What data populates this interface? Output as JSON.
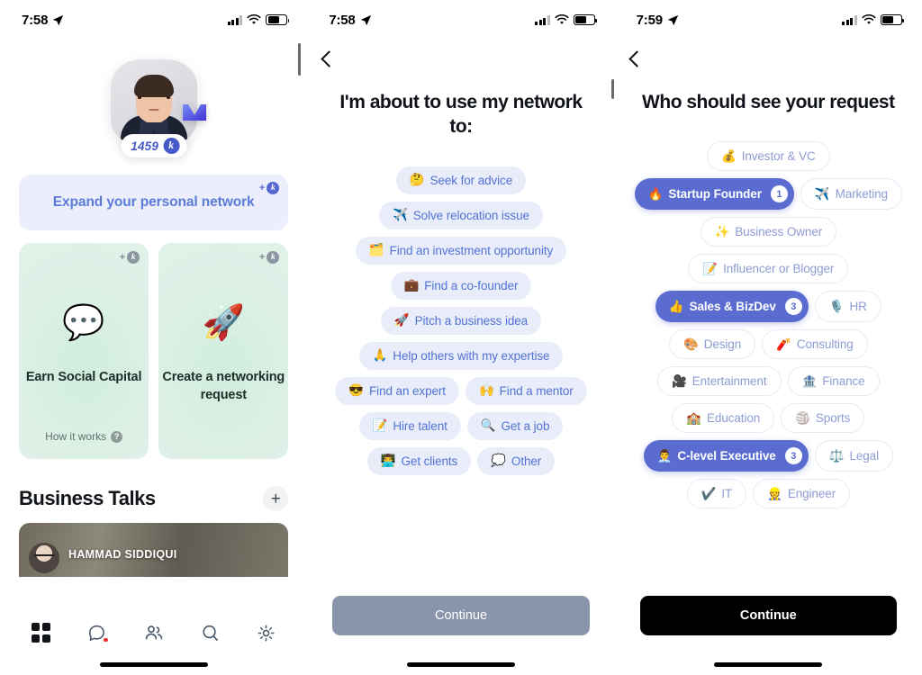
{
  "panel1": {
    "status": {
      "time": "7:58",
      "location_icon": "location-arrow-icon"
    },
    "profile": {
      "score": "1459",
      "coin_letter": "k",
      "crown_icon": "crown-badge-icon"
    },
    "expand_card": {
      "label": "Expand your personal network",
      "plus": "+",
      "coin": "k"
    },
    "cards": [
      {
        "emoji": "💬",
        "title": "Earn Social Capital",
        "footer": "How it works",
        "plus": "+",
        "coin": "k"
      },
      {
        "emoji": "🚀",
        "title": "Create a networking request",
        "footer": "",
        "plus": "+",
        "coin": "k"
      }
    ],
    "business_talks": {
      "title": "Business Talks",
      "add_label": "+",
      "featured_name": "HAMMAD SIDDIQUI"
    },
    "tabs": [
      {
        "name": "grid",
        "active": true
      },
      {
        "name": "chat",
        "active": false,
        "badge": true
      },
      {
        "name": "people",
        "active": false
      },
      {
        "name": "search",
        "active": false
      },
      {
        "name": "settings",
        "active": false
      }
    ]
  },
  "panel2": {
    "status": {
      "time": "7:58"
    },
    "back_label": "Back",
    "title": "I'm about to use my network to:",
    "options": [
      {
        "emoji": "🤔",
        "label": "Seek for advice"
      },
      {
        "emoji": "✈️",
        "label": "Solve relocation issue"
      },
      {
        "emoji": "🗂️",
        "label": "Find an investment opportunity"
      },
      {
        "emoji": "💼",
        "label": "Find a co-founder"
      },
      {
        "emoji": "🚀",
        "label": "Pitch a business idea"
      },
      {
        "emoji": "🙏",
        "label": "Help others with my expertise"
      },
      {
        "emoji": "😎",
        "label": "Find an expert"
      },
      {
        "emoji": "🙌",
        "label": "Find a mentor"
      },
      {
        "emoji": "📝",
        "label": "Hire talent"
      },
      {
        "emoji": "🔍",
        "label": "Get a job"
      },
      {
        "emoji": "👨‍💻",
        "label": "Get clients"
      },
      {
        "emoji": "💭",
        "label": "Other"
      }
    ],
    "cta": "Continue"
  },
  "panel3": {
    "status": {
      "time": "7:59"
    },
    "back_label": "Back",
    "title": "Who should see your request",
    "tags": [
      {
        "emoji": "💰",
        "label": "Investor & VC",
        "selected": false
      },
      {
        "emoji": "🔥",
        "label": "Startup Founder",
        "selected": true,
        "count": "1"
      },
      {
        "emoji": "✈️",
        "label": "Marketing",
        "selected": false
      },
      {
        "emoji": "✨",
        "label": "Business Owner",
        "selected": false
      },
      {
        "emoji": "📝",
        "label": "Influencer or Blogger",
        "selected": false
      },
      {
        "emoji": "👍",
        "label": "Sales & BizDev",
        "selected": true,
        "count": "3"
      },
      {
        "emoji": "🎙️",
        "label": "HR",
        "selected": false
      },
      {
        "emoji": "🎨",
        "label": "Design",
        "selected": false
      },
      {
        "emoji": "🧨",
        "label": "Consulting",
        "selected": false
      },
      {
        "emoji": "🎥",
        "label": "Entertainment",
        "selected": false
      },
      {
        "emoji": "🏦",
        "label": "Finance",
        "selected": false
      },
      {
        "emoji": "🏫",
        "label": "Education",
        "selected": false
      },
      {
        "emoji": "🏐",
        "label": "Sports",
        "selected": false
      },
      {
        "emoji": "👨‍💼",
        "label": "C-level Executive",
        "selected": true,
        "count": "3"
      },
      {
        "emoji": "⚖️",
        "label": "Legal",
        "selected": false
      },
      {
        "emoji": "✔️",
        "label": "IT",
        "selected": false
      },
      {
        "emoji": "👷",
        "label": "Engineer",
        "selected": false
      }
    ],
    "cta": "Continue",
    "accent": "#5b6cd0"
  }
}
